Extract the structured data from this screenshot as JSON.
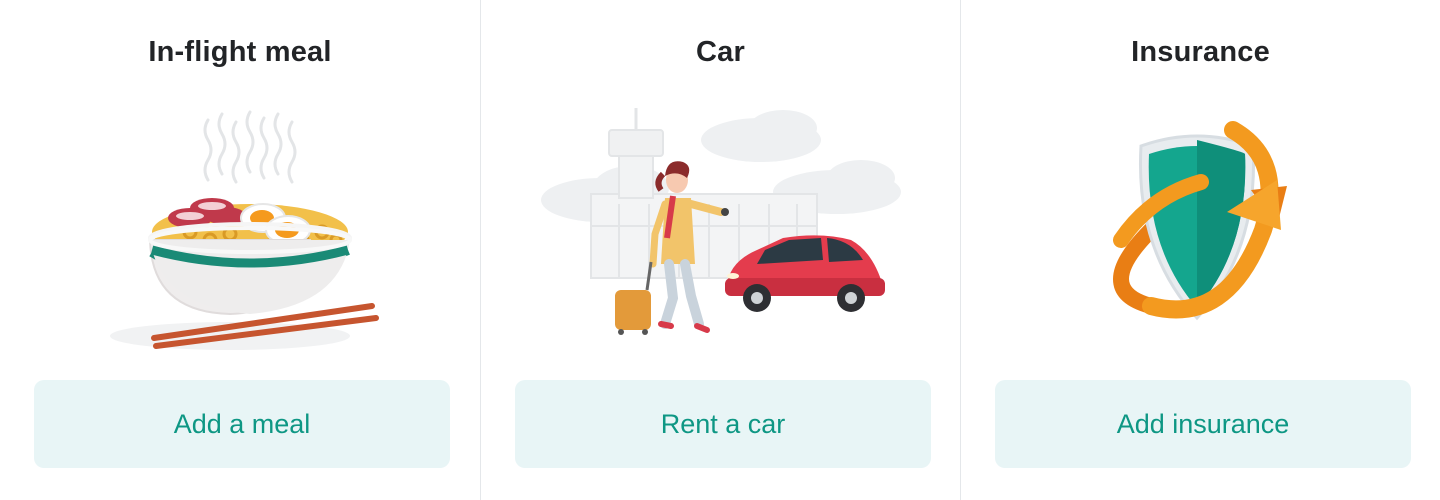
{
  "cards": [
    {
      "title": "In-flight meal",
      "button_label": "Add a meal",
      "illustration": "noodle-bowl-icon"
    },
    {
      "title": "Car",
      "button_label": "Rent a car",
      "illustration": "car-rental-scene-icon"
    },
    {
      "title": "Insurance",
      "button_label": "Add insurance",
      "illustration": "insurance-shield-icon"
    }
  ],
  "colors": {
    "accent_text": "#0e9784",
    "button_bg": "#e8f5f6",
    "title_text": "#222427",
    "divider": "#e4e7ea"
  }
}
